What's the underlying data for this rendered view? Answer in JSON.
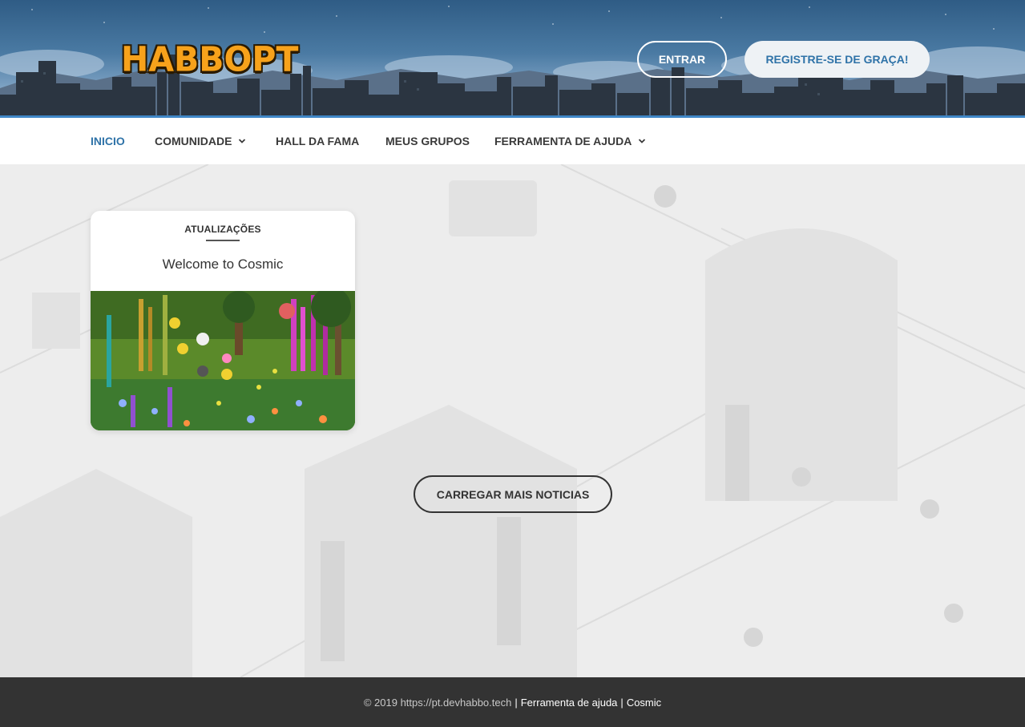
{
  "header": {
    "logo_text": "HABBOPT",
    "login_label": "ENTRAR",
    "register_label": "REGISTRE-SE DE GRAÇA!"
  },
  "nav": {
    "items": [
      {
        "label": "INICIO",
        "active": true
      },
      {
        "label": "COMUNIDADE",
        "dropdown": true
      },
      {
        "label": "HALL DA FAMA"
      },
      {
        "label": "MEUS GRUPOS"
      },
      {
        "label": "FERRAMENTA DE AJUDA",
        "dropdown": true
      }
    ]
  },
  "news": {
    "category": "ATUALIZAÇÕES",
    "headline": "Welcome to Cosmic"
  },
  "load_more_label": "CARREGAR MAIS NOTICIAS",
  "footer": {
    "copyright": "© 2019 https://pt.devhabbo.tech",
    "help_link": "Ferramenta de ajuda",
    "brand_link": "Cosmic"
  },
  "colors": {
    "accent": "#2f73a8",
    "logo": "#f7a21b",
    "footer_bg": "#333333"
  }
}
